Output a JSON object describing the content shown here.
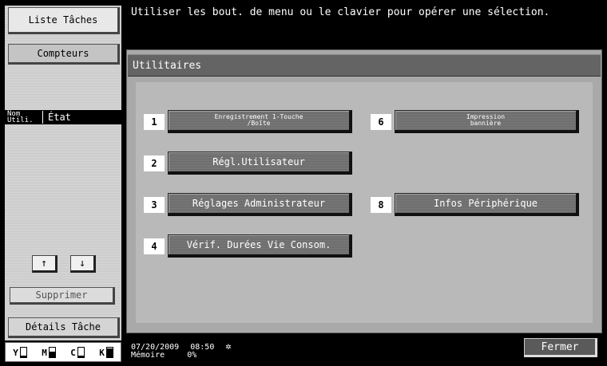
{
  "left_panel": {
    "liste_taches": "Liste Tâches",
    "compteurs": "Compteurs",
    "col_nom_line1": "Nom",
    "col_nom_line2": "Utili.",
    "col_etat": "État",
    "up_arrow": "↑",
    "down_arrow": "↓",
    "supprimer": "Supprimer",
    "details_tache": "Détails Tâche"
  },
  "toner": [
    {
      "label": "Y",
      "level": 0.15
    },
    {
      "label": "M",
      "level": 0.55
    },
    {
      "label": "C",
      "level": 0.15
    },
    {
      "label": "K",
      "level": 0.9
    }
  ],
  "message": "Utiliser les bout. de menu ou le clavier pour opérer une sélection.",
  "screen_title": "Utilitaires",
  "menu": [
    {
      "num": "1",
      "line1": "Enregistrement 1-Touche",
      "line2": "/Boîte"
    },
    {
      "num": "6",
      "line1": "Impression",
      "line2": "bannière"
    },
    {
      "num": "2",
      "label": "Régl.Utilisateur"
    },
    {
      "num": "3",
      "label": "Réglages Administrateur"
    },
    {
      "num": "8",
      "label": "Infos Périphérique"
    },
    {
      "num": "4",
      "label": "Vérif. Durées Vie Consom."
    }
  ],
  "status": {
    "date": "07/20/2009",
    "time": "08:50",
    "memory_label": "Mémoire",
    "memory_value": "0%"
  },
  "fermer": "Fermer"
}
